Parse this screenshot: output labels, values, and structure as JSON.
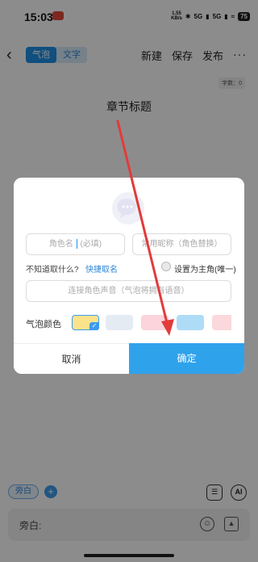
{
  "status": {
    "time": "15:03",
    "notification_badge": "",
    "net_speed_top": "1.55",
    "net_speed_bottom": "KB/s",
    "signal1": "5G",
    "signal2": "5G",
    "battery": "75"
  },
  "toolbar": {
    "back_icon": "chevron-left",
    "mode_bubble": "气泡",
    "mode_text": "文字",
    "new_label": "新建",
    "save_label": "保存",
    "publish_label": "发布",
    "more_icon": "···"
  },
  "editor": {
    "word_count": "字数：0",
    "chapter_title": "章节标题"
  },
  "bottom": {
    "narration_chip": "旁白",
    "add_symbol": "+",
    "ai_label": "AI",
    "input_label": "旁白:"
  },
  "dialog": {
    "name_placeholder_a": "角色名",
    "name_placeholder_b": "(必填)",
    "nickname_placeholder": "常用昵称（角色替换）",
    "hint_text": "不知道取什么?",
    "quick_name": "快捷取名",
    "protagonist_label": "设置为主角(唯一)",
    "voice_placeholder": "连接角色声音（气泡将拥有语音）",
    "color_label": "气泡颜色",
    "swatch_colors": [
      "#fbe38c",
      "#e4ebf3",
      "#fbd4dc",
      "#aedcf7",
      "#fbd8dc"
    ],
    "selected_swatch_check": "✓",
    "cancel_label": "取消",
    "confirm_label": "确定"
  },
  "colors": {
    "accent": "#1e90e6",
    "confirm": "#2fa2ec",
    "annotation_arrow": "#e23b3b"
  }
}
